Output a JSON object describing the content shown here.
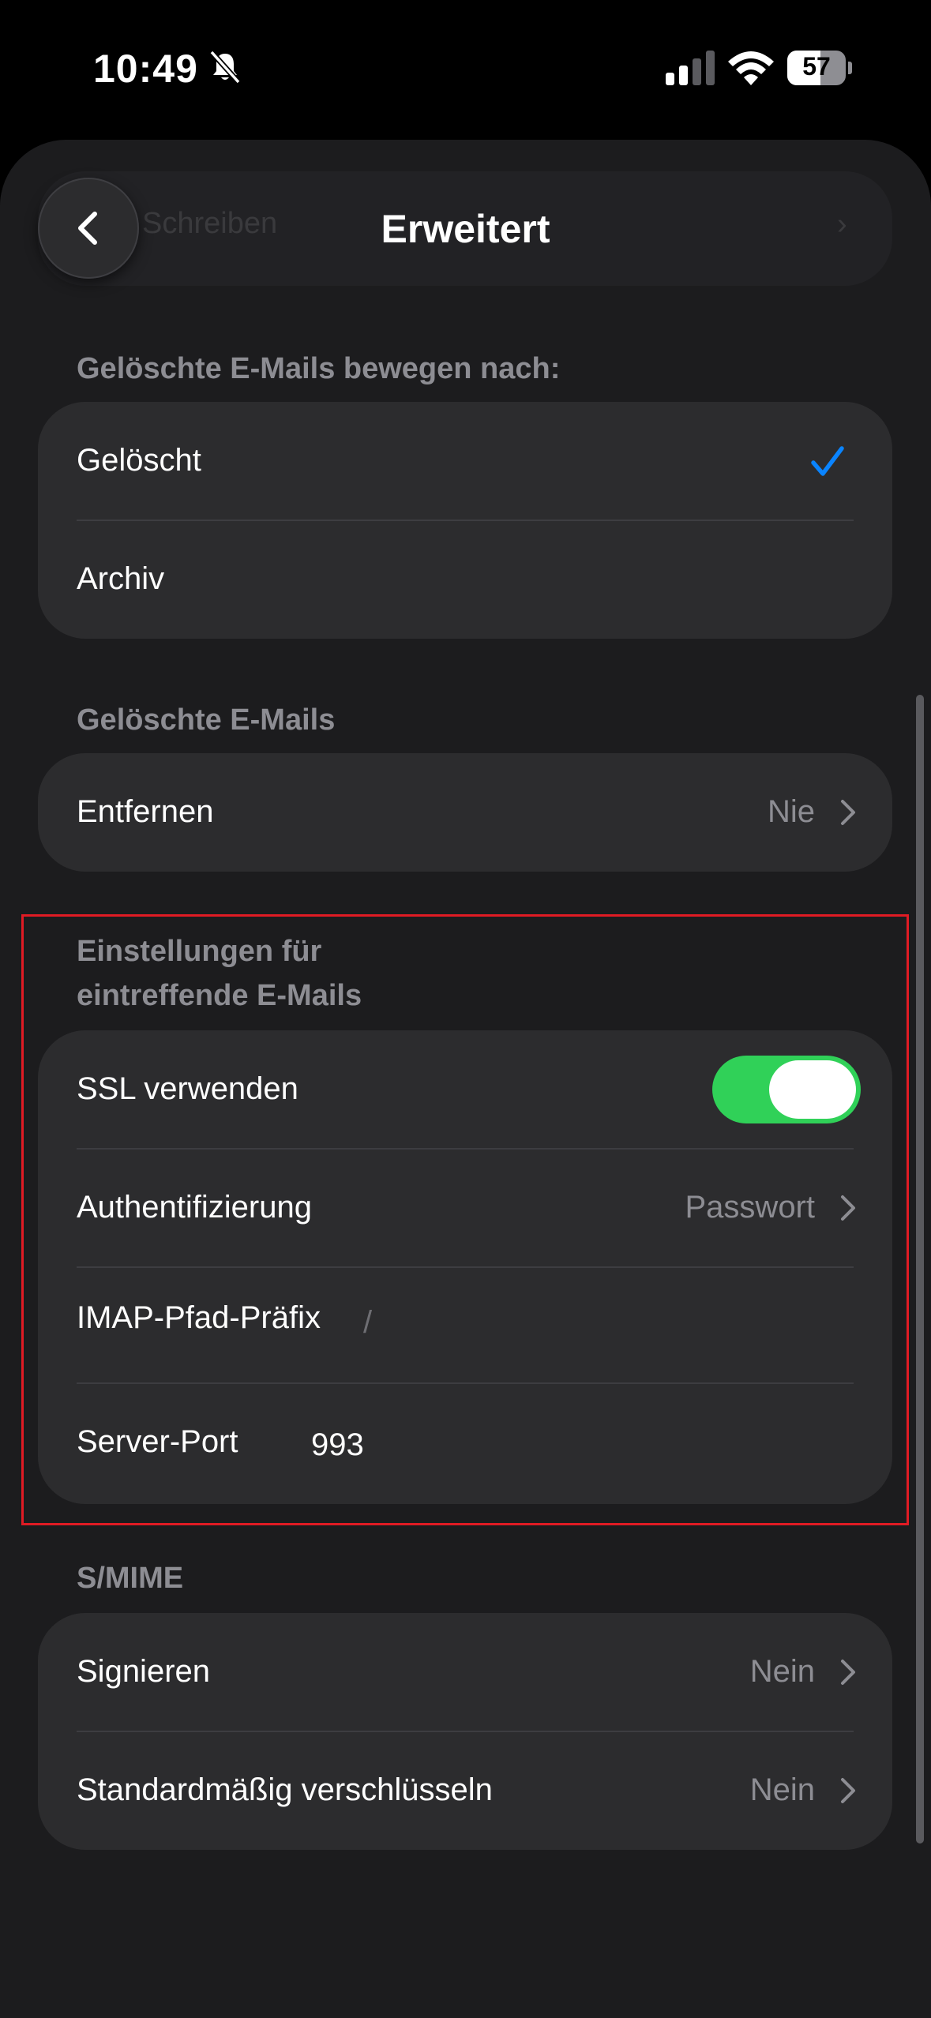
{
  "status_bar": {
    "time": "10:49",
    "battery_level": "57",
    "battery_fraction": 0.57
  },
  "nav": {
    "title": "Erweitert",
    "ghost_text": "Schreiben",
    "back_icon": "chevron-left-icon"
  },
  "sections": {
    "deleted_move": {
      "header": "Gelöschte E-Mails bewegen nach:",
      "options": [
        {
          "label": "Gelöscht",
          "selected": true
        },
        {
          "label": "Archiv",
          "selected": false
        }
      ]
    },
    "deleted_emails": {
      "header": "Gelöschte E-Mails",
      "rows": [
        {
          "label": "Entfernen",
          "value": "Nie"
        }
      ]
    },
    "incoming": {
      "header_line1": "Einstellungen für",
      "header_line2": "eintreffende E-Mails",
      "ssl": {
        "label": "SSL verwenden",
        "on": true
      },
      "auth": {
        "label": "Authentifizierung",
        "value": "Passwort"
      },
      "imap_prefix": {
        "label": "IMAP-Pfad-Präfix",
        "value": "/"
      },
      "server_port": {
        "label": "Server-Port",
        "value": "993"
      }
    },
    "smime": {
      "header": "S/MIME",
      "rows": [
        {
          "label": "Signieren",
          "value": "Nein"
        },
        {
          "label": "Standardmäßig verschlüsseln",
          "value": "Nein"
        }
      ]
    }
  },
  "colors": {
    "background": "#1c1c1e",
    "cell": "#2c2c2e",
    "accent": "#0a84ff",
    "toggle_on": "#30d158",
    "secondary_text": "#8d8d93",
    "highlight_box": "#e01b24"
  }
}
